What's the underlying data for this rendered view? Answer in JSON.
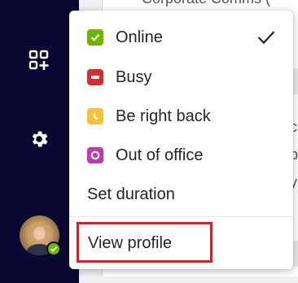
{
  "background": {
    "lines": [
      "Corporate Comms (",
      "c",
      "p",
      "y"
    ]
  },
  "status_menu": {
    "items": [
      {
        "label": "Online",
        "status": "available",
        "color": "#6bb700",
        "selected": true
      },
      {
        "label": "Busy",
        "status": "busy",
        "color": "#d92c2c",
        "selected": false
      },
      {
        "label": "Be right back",
        "status": "away",
        "color": "#f8c13a",
        "selected": false
      },
      {
        "label": "Out of office",
        "status": "out-of-office",
        "color": "#c239b3",
        "selected": false
      }
    ],
    "set_duration_label": "Set duration",
    "view_profile_label": "View profile"
  },
  "rail": {
    "icons": [
      "apps-add-icon",
      "settings-gear-icon"
    ],
    "rail_color": "#0a0733",
    "presence_color": "#6bb700"
  }
}
